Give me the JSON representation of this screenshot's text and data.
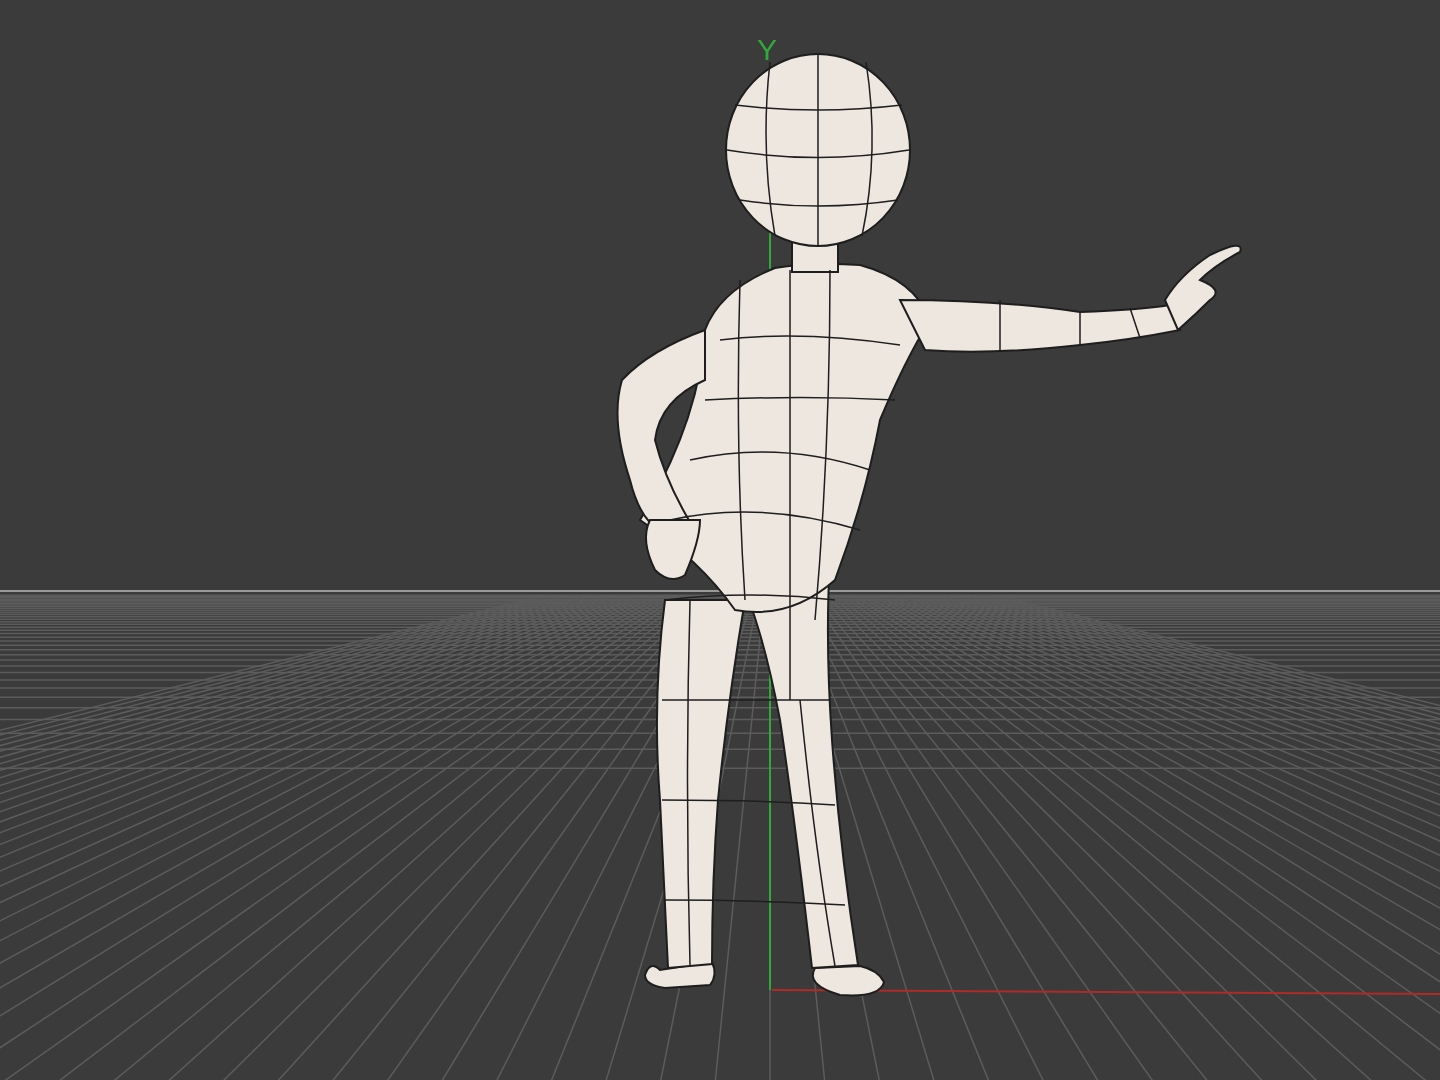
{
  "viewport": {
    "y_axis_label": "Y"
  }
}
